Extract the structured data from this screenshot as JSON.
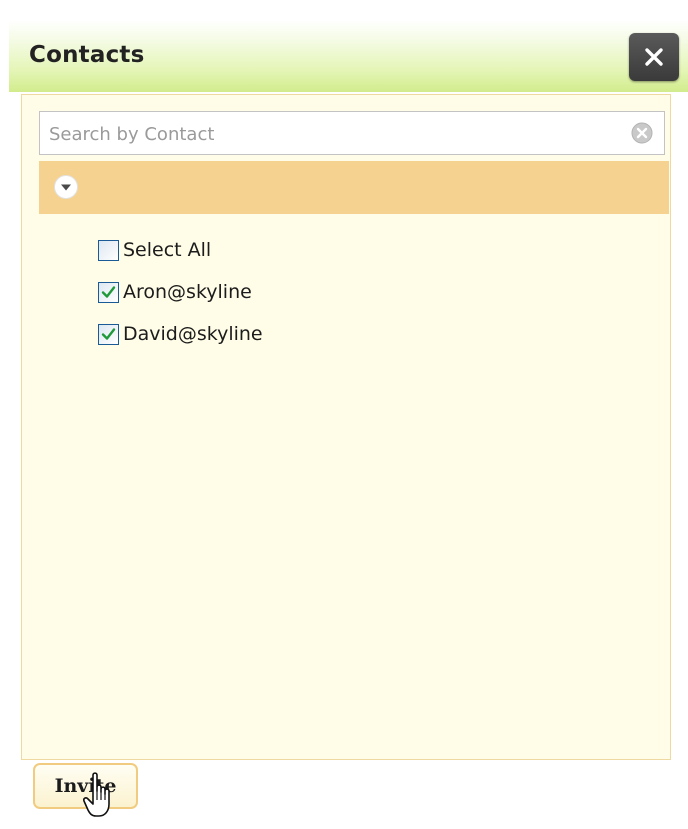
{
  "dialog": {
    "title": "Contacts",
    "close_icon": "close-icon"
  },
  "search": {
    "placeholder": "Search by Contact",
    "value": "",
    "clear_icon": "clear-circle-icon"
  },
  "group": {
    "toggle_icon": "chevron-down-circle-icon",
    "label": ""
  },
  "contacts": {
    "select_all": {
      "label": "Select All",
      "checked": false
    },
    "items": [
      {
        "label": "Aron@skyline",
        "checked": true
      },
      {
        "label": "David@skyline",
        "checked": true
      }
    ]
  },
  "actions": {
    "invite_label": "Invite"
  },
  "colors": {
    "titlebar_accent": "#d2ec8c",
    "panel_bg": "#fffde8",
    "group_header_bg": "#f6d290",
    "checkbox_border": "#1a5b96",
    "checkmark": "#1f9a3a",
    "close_button_bg": "#3a3a3a"
  }
}
